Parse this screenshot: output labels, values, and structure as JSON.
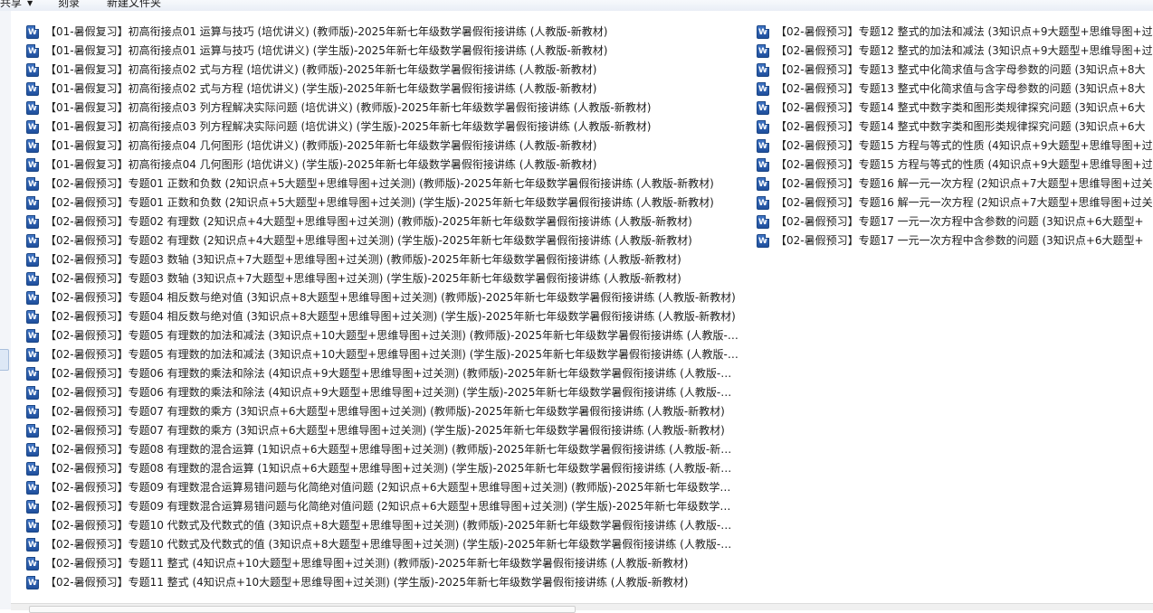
{
  "toolbar": {
    "share_label": "共享",
    "burn_label": "刻录",
    "new_folder_label": "新建文件夹"
  },
  "file_icon": "word-document-icon",
  "file_icon_letter": "W",
  "files_col1": [
    "【01-暑假复习】初高衔接点01 运算与技巧 (培优讲义) (教师版)-2025年新七年级数学暑假衔接讲练 (人教版-新教材)",
    "【01-暑假复习】初高衔接点01 运算与技巧 (培优讲义) (学生版)-2025年新七年级数学暑假衔接讲练 (人教版-新教材)",
    "【01-暑假复习】初高衔接点02 式与方程 (培优讲义) (教师版)-2025年新七年级数学暑假衔接讲练 (人教版-新教材)",
    "【01-暑假复习】初高衔接点02 式与方程 (培优讲义) (学生版)-2025年新七年级数学暑假衔接讲练 (人教版-新教材)",
    "【01-暑假复习】初高衔接点03 列方程解决实际问题 (培优讲义) (教师版)-2025年新七年级数学暑假衔接讲练 (人教版-新教材)",
    "【01-暑假复习】初高衔接点03 列方程解决实际问题 (培优讲义) (学生版)-2025年新七年级数学暑假衔接讲练 (人教版-新教材)",
    "【01-暑假复习】初高衔接点04 几何图形 (培优讲义) (教师版)-2025年新七年级数学暑假衔接讲练 (人教版-新教材)",
    "【01-暑假复习】初高衔接点04 几何图形 (培优讲义) (学生版)-2025年新七年级数学暑假衔接讲练 (人教版-新教材)",
    "【02-暑假预习】专题01 正数和负数 (2知识点+5大题型+思维导图+过关测) (教师版)-2025年新七年级数学暑假衔接讲练 (人教版-新教材)",
    "【02-暑假预习】专题01 正数和负数 (2知识点+5大题型+思维导图+过关测) (学生版)-2025年新七年级数学暑假衔接讲练 (人教版-新教材)",
    "【02-暑假预习】专题02 有理数 (2知识点+4大题型+思维导图+过关测) (教师版)-2025年新七年级数学暑假衔接讲练 (人教版-新教材)",
    "【02-暑假预习】专题02 有理数 (2知识点+4大题型+思维导图+过关测) (学生版)-2025年新七年级数学暑假衔接讲练 (人教版-新教材)",
    "【02-暑假预习】专题03 数轴 (3知识点+7大题型+思维导图+过关测) (教师版)-2025年新七年级数学暑假衔接讲练 (人教版-新教材)",
    "【02-暑假预习】专题03 数轴 (3知识点+7大题型+思维导图+过关测) (学生版)-2025年新七年级数学暑假衔接讲练 (人教版-新教材)",
    "【02-暑假预习】专题04 相反数与绝对值 (3知识点+8大题型+思维导图+过关测) (教师版)-2025年新七年级数学暑假衔接讲练 (人教版-新教材)",
    "【02-暑假预习】专题04 相反数与绝对值 (3知识点+8大题型+思维导图+过关测) (学生版)-2025年新七年级数学暑假衔接讲练 (人教版-新教材)",
    "【02-暑假预习】专题05 有理数的加法和减法 (3知识点+10大题型+思维导图+过关测) (教师版)-2025年新七年级数学暑假衔接讲练 (人教版-新...",
    "【02-暑假预习】专题05 有理数的加法和减法 (3知识点+10大题型+思维导图+过关测) (学生版)-2025年新七年级数学暑假衔接讲练 (人教版-新...",
    "【02-暑假预习】专题06 有理数的乘法和除法 (4知识点+9大题型+思维导图+过关测) (教师版)-2025年新七年级数学暑假衔接讲练 (人教版-新教...",
    "【02-暑假预习】专题06 有理数的乘法和除法 (4知识点+9大题型+思维导图+过关测) (学生版)-2025年新七年级数学暑假衔接讲练 (人教版-新教...",
    "【02-暑假预习】专题07 有理数的乘方 (3知识点+6大题型+思维导图+过关测) (教师版)-2025年新七年级数学暑假衔接讲练 (人教版-新教材)",
    "【02-暑假预习】专题07 有理数的乘方 (3知识点+6大题型+思维导图+过关测) (学生版)-2025年新七年级数学暑假衔接讲练 (人教版-新教材)",
    "【02-暑假预习】专题08 有理数的混合运算 (1知识点+6大题型+思维导图+过关测) (教师版)-2025年新七年级数学暑假衔接讲练 (人教版-新教材)",
    "【02-暑假预习】专题08 有理数的混合运算 (1知识点+6大题型+思维导图+过关测) (学生版)-2025年新七年级数学暑假衔接讲练 (人教版-新教材)",
    "【02-暑假预习】专题09 有理数混合运算易错问题与化简绝对值问题 (2知识点+6大题型+思维导图+过关测) (教师版)-2025年新七年级数学暑假...",
    "【02-暑假预习】专题09 有理数混合运算易错问题与化简绝对值问题 (2知识点+6大题型+思维导图+过关测) (学生版)-2025年新七年级数学暑假...",
    "【02-暑假预习】专题10 代数式及代数式的值 (3知识点+8大题型+思维导图+过关测) (教师版)-2025年新七年级数学暑假衔接讲练 (人教版-新教...",
    "【02-暑假预习】专题10 代数式及代数式的值 (3知识点+8大题型+思维导图+过关测) (学生版)-2025年新七年级数学暑假衔接讲练 (人教版-新教...",
    "【02-暑假预习】专题11 整式 (4知识点+10大题型+思维导图+过关测) (教师版)-2025年新七年级数学暑假衔接讲练 (人教版-新教材)",
    "【02-暑假预习】专题11 整式 (4知识点+10大题型+思维导图+过关测) (学生版)-2025年新七年级数学暑假衔接讲练 (人教版-新教材)"
  ],
  "files_col2": [
    "【02-暑假预习】专题12 整式的加法和减法 (3知识点+9大题型+思维导图+过",
    "【02-暑假预习】专题12 整式的加法和减法 (3知识点+9大题型+思维导图+过",
    "【02-暑假预习】专题13 整式中化简求值与含字母参数的问题 (3知识点+8大",
    "【02-暑假预习】专题13 整式中化简求值与含字母参数的问题 (3知识点+8大",
    "【02-暑假预习】专题14 整式中数字类和图形类规律探究问题 (3知识点+6大",
    "【02-暑假预习】专题14 整式中数字类和图形类规律探究问题 (3知识点+6大",
    "【02-暑假预习】专题15 方程与等式的性质 (4知识点+9大题型+思维导图+过",
    "【02-暑假预习】专题15 方程与等式的性质 (4知识点+9大题型+思维导图+过",
    "【02-暑假预习】专题16 解一元一次方程 (2知识点+7大题型+思维导图+过关",
    "【02-暑假预习】专题16 解一元一次方程 (2知识点+7大题型+思维导图+过关",
    "【02-暑假预习】专题17 一元一次方程中含参数的问题 (3知识点+6大题型+",
    "【02-暑假预习】专题17 一元一次方程中含参数的问题 (3知识点+6大题型+"
  ]
}
